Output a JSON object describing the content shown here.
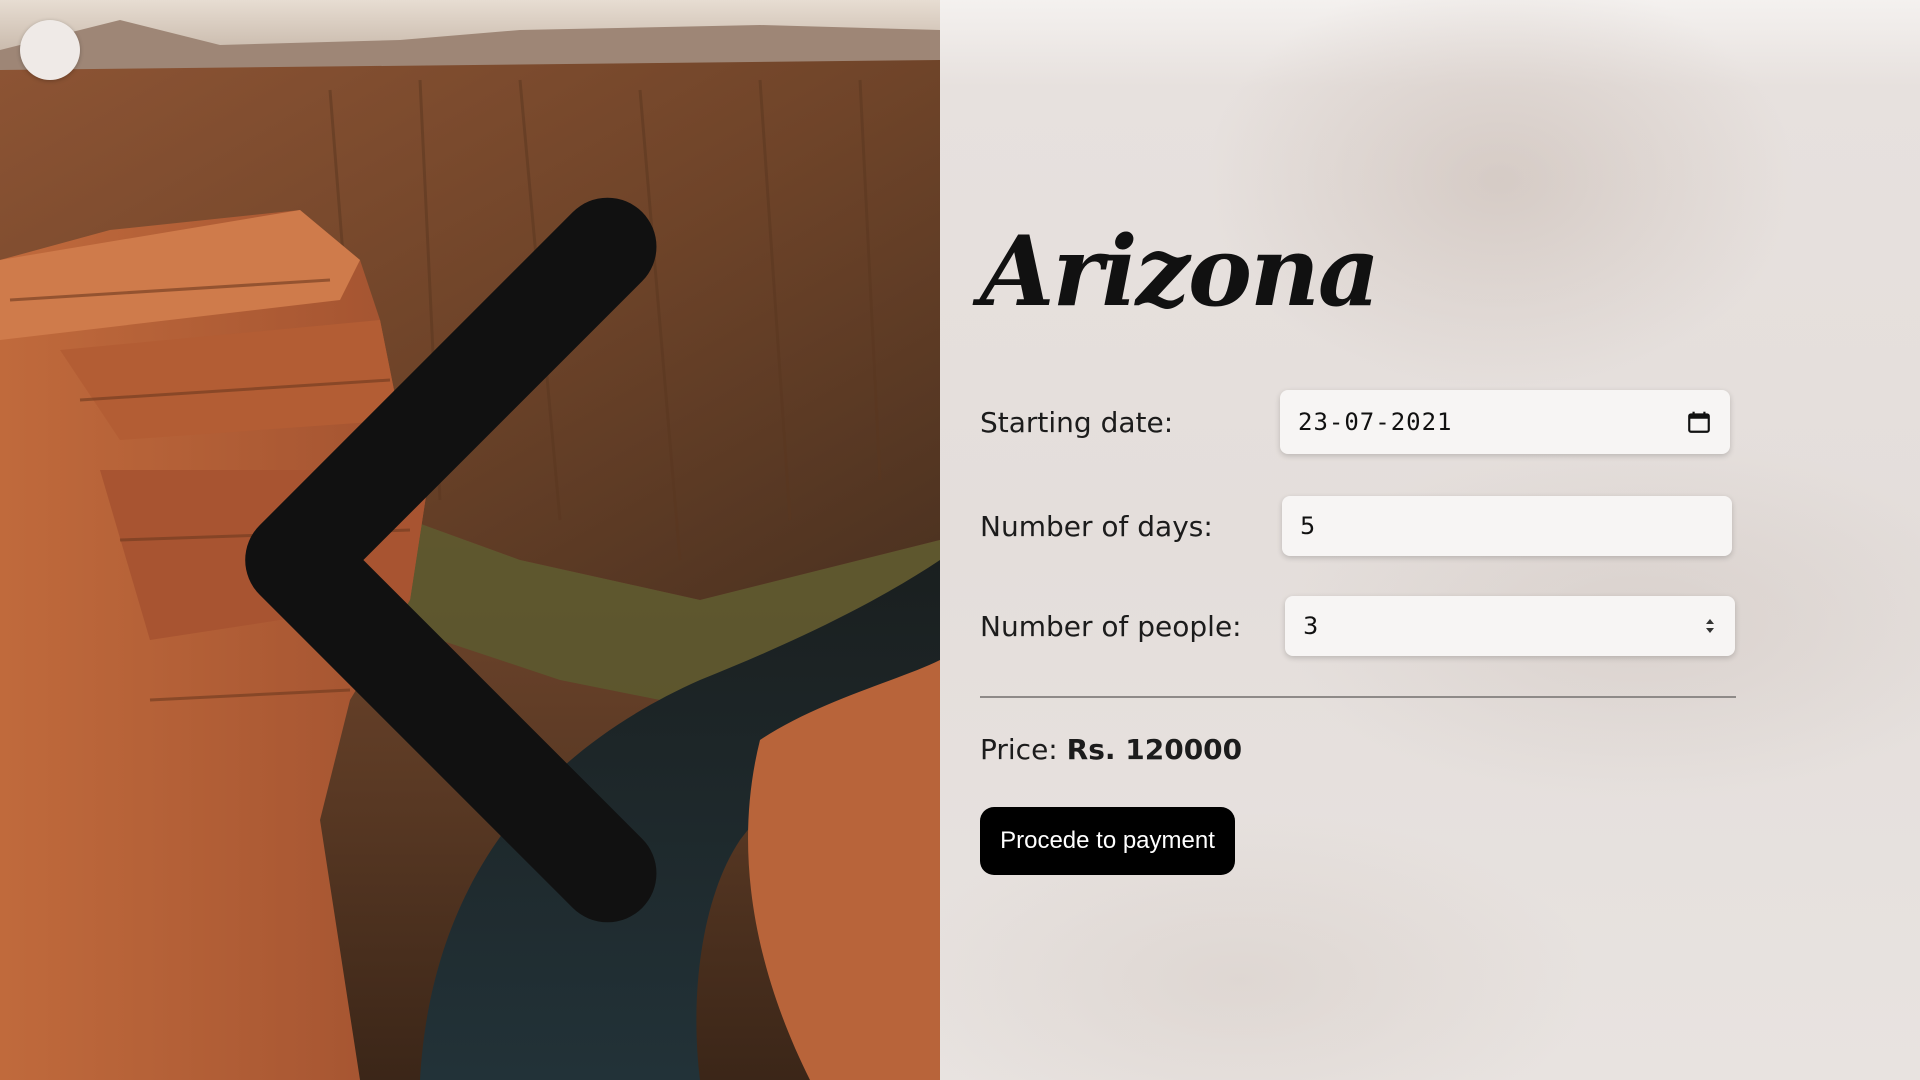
{
  "hero": {
    "back_icon": "chevron-left-icon",
    "image_subject": "canyon"
  },
  "form": {
    "title": "Arizona",
    "starting_date": {
      "label": "Starting date:",
      "value": "23-07-2021",
      "icon": "calendar-icon"
    },
    "days": {
      "label": "Number of days:",
      "value": "5"
    },
    "people": {
      "label": "Number of people:",
      "value": "3",
      "icon": "stepper-icon"
    },
    "price": {
      "label": "Price:",
      "value": "Rs. 120000"
    },
    "pay_button": "Procede to payment"
  },
  "colors": {
    "button_bg": "#000000",
    "button_text": "#ffffff",
    "field_bg": "#f7f5f4"
  }
}
